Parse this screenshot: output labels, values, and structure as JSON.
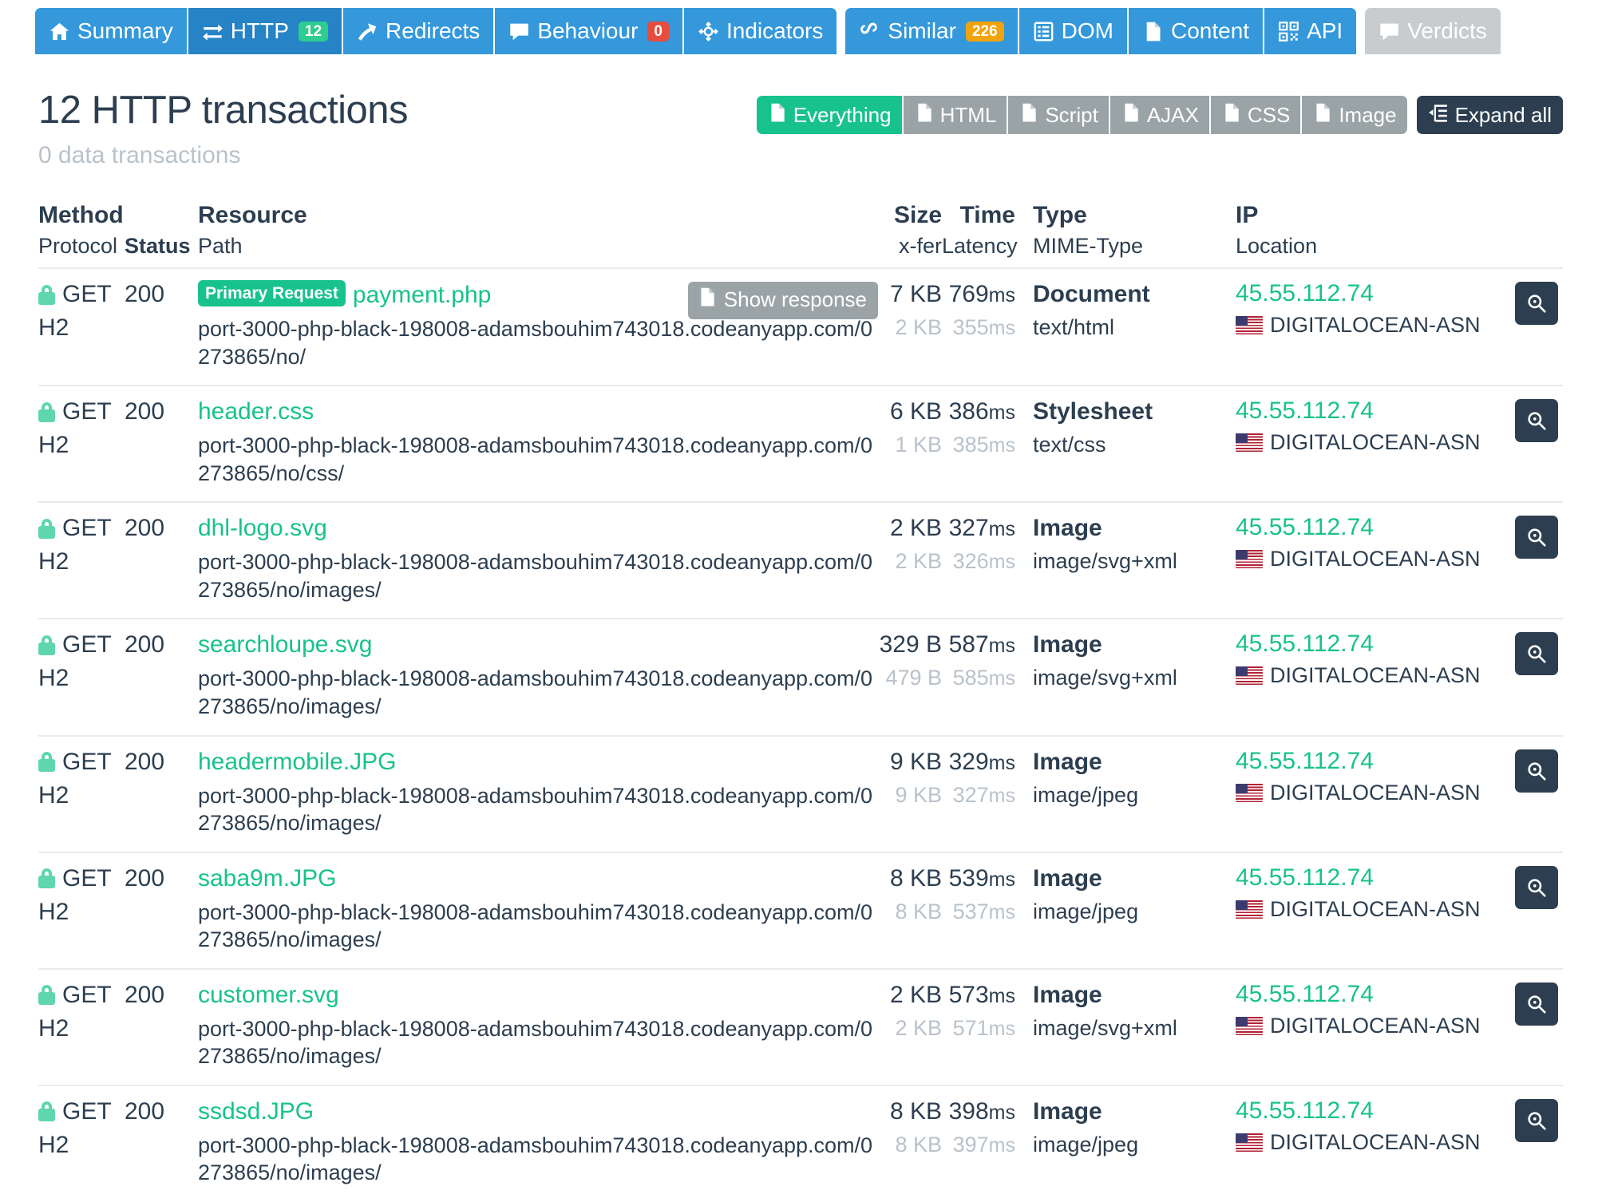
{
  "tabs": {
    "groups": [
      {
        "items": [
          {
            "label": "Summary",
            "icon": "home-icon",
            "badge": null,
            "badge_color": null,
            "active": false,
            "disabled": false
          },
          {
            "label": "HTTP",
            "icon": "transfer-icon",
            "badge": "12",
            "badge_color": "#2ecc8f",
            "active": true,
            "disabled": false
          },
          {
            "label": "Redirects",
            "icon": "arrow-icon",
            "badge": null,
            "badge_color": null,
            "active": false,
            "disabled": false
          },
          {
            "label": "Behaviour",
            "icon": "comment-icon",
            "badge": "0",
            "badge_color": "#e74c3c",
            "active": false,
            "disabled": false
          },
          {
            "label": "Indicators",
            "icon": "crosshair-icon",
            "badge": null,
            "badge_color": null,
            "active": false,
            "disabled": false
          }
        ]
      },
      {
        "items": [
          {
            "label": "Similar",
            "icon": "link-icon",
            "badge": "226",
            "badge_color": "#f0a30a",
            "active": false,
            "disabled": false
          },
          {
            "label": "DOM",
            "icon": "list-icon",
            "badge": null,
            "badge_color": null,
            "active": false,
            "disabled": false
          },
          {
            "label": "Content",
            "icon": "page-icon",
            "badge": null,
            "badge_color": null,
            "active": false,
            "disabled": false
          },
          {
            "label": "API",
            "icon": "qrcode-icon",
            "badge": null,
            "badge_color": null,
            "active": false,
            "disabled": false
          }
        ]
      },
      {
        "items": [
          {
            "label": "Verdicts",
            "icon": "comment-icon",
            "badge": null,
            "badge_color": null,
            "active": false,
            "disabled": true
          }
        ]
      }
    ]
  },
  "page": {
    "title": "12 HTTP transactions",
    "subtitle": "0 data transactions"
  },
  "filters": {
    "buttons": [
      {
        "label": "Everything",
        "active": true
      },
      {
        "label": "HTML",
        "active": false
      },
      {
        "label": "Script",
        "active": false
      },
      {
        "label": "AJAX",
        "active": false
      },
      {
        "label": "CSS",
        "active": false
      },
      {
        "label": "Image",
        "active": false
      }
    ],
    "expand_all": "Expand all",
    "active_color": "#18c28c",
    "inactive_color": "#9aa4a6"
  },
  "table": {
    "headers": {
      "method_top": "Method",
      "method_sub": "Protocol",
      "status_sub": "Status",
      "resource_top": "Resource",
      "resource_sub": "Path",
      "size_top": "Size",
      "size_sub": "x-fer",
      "time_top": "Time",
      "time_sub": "Latency",
      "type_top": "Type",
      "type_sub": "MIME-Type",
      "ip_top": "IP",
      "ip_sub": "Location"
    },
    "show_response_label": "Show response",
    "primary_request_label": "Primary Request",
    "rows": [
      {
        "method": "GET",
        "protocol": "H2",
        "status": "200",
        "resource": "payment.php",
        "primary": true,
        "show_response": true,
        "path": "port-3000-php-black-198008-adamsbouhim743018.codeanyapp.com/0273865/no/",
        "size": "7 KB",
        "xfer": "2 KB",
        "time": "769ms",
        "latency": "355ms",
        "type": "Document",
        "mime": "text/html",
        "ip": "45.55.112.74",
        "location": "DIGITALOCEAN-ASN"
      },
      {
        "method": "GET",
        "protocol": "H2",
        "status": "200",
        "resource": "header.css",
        "primary": false,
        "show_response": false,
        "path": "port-3000-php-black-198008-adamsbouhim743018.codeanyapp.com/0273865/no/css/",
        "size": "6 KB",
        "xfer": "1 KB",
        "time": "386ms",
        "latency": "385ms",
        "type": "Stylesheet",
        "mime": "text/css",
        "ip": "45.55.112.74",
        "location": "DIGITALOCEAN-ASN"
      },
      {
        "method": "GET",
        "protocol": "H2",
        "status": "200",
        "resource": "dhl-logo.svg",
        "primary": false,
        "show_response": false,
        "path": "port-3000-php-black-198008-adamsbouhim743018.codeanyapp.com/0273865/no/images/",
        "size": "2 KB",
        "xfer": "2 KB",
        "time": "327ms",
        "latency": "326ms",
        "type": "Image",
        "mime": "image/svg+xml",
        "ip": "45.55.112.74",
        "location": "DIGITALOCEAN-ASN"
      },
      {
        "method": "GET",
        "protocol": "H2",
        "status": "200",
        "resource": "searchloupe.svg",
        "primary": false,
        "show_response": false,
        "path": "port-3000-php-black-198008-adamsbouhim743018.codeanyapp.com/0273865/no/images/",
        "size": "329 B",
        "xfer": "479 B",
        "time": "587ms",
        "latency": "585ms",
        "type": "Image",
        "mime": "image/svg+xml",
        "ip": "45.55.112.74",
        "location": "DIGITALOCEAN-ASN"
      },
      {
        "method": "GET",
        "protocol": "H2",
        "status": "200",
        "resource": "headermobile.JPG",
        "primary": false,
        "show_response": false,
        "path": "port-3000-php-black-198008-adamsbouhim743018.codeanyapp.com/0273865/no/images/",
        "size": "9 KB",
        "xfer": "9 KB",
        "time": "329ms",
        "latency": "327ms",
        "type": "Image",
        "mime": "image/jpeg",
        "ip": "45.55.112.74",
        "location": "DIGITALOCEAN-ASN"
      },
      {
        "method": "GET",
        "protocol": "H2",
        "status": "200",
        "resource": "saba9m.JPG",
        "primary": false,
        "show_response": false,
        "path": "port-3000-php-black-198008-adamsbouhim743018.codeanyapp.com/0273865/no/images/",
        "size": "8 KB",
        "xfer": "8 KB",
        "time": "539ms",
        "latency": "537ms",
        "type": "Image",
        "mime": "image/jpeg",
        "ip": "45.55.112.74",
        "location": "DIGITALOCEAN-ASN"
      },
      {
        "method": "GET",
        "protocol": "H2",
        "status": "200",
        "resource": "customer.svg",
        "primary": false,
        "show_response": false,
        "path": "port-3000-php-black-198008-adamsbouhim743018.codeanyapp.com/0273865/no/images/",
        "size": "2 KB",
        "xfer": "2 KB",
        "time": "573ms",
        "latency": "571ms",
        "type": "Image",
        "mime": "image/svg+xml",
        "ip": "45.55.112.74",
        "location": "DIGITALOCEAN-ASN"
      },
      {
        "method": "GET",
        "protocol": "H2",
        "status": "200",
        "resource": "ssdsd.JPG",
        "primary": false,
        "show_response": false,
        "path": "port-3000-php-black-198008-adamsbouhim743018.codeanyapp.com/0273865/no/images/",
        "size": "8 KB",
        "xfer": "8 KB",
        "time": "398ms",
        "latency": "397ms",
        "type": "Image",
        "mime": "image/jpeg",
        "ip": "45.55.112.74",
        "location": "DIGITALOCEAN-ASN"
      }
    ]
  }
}
